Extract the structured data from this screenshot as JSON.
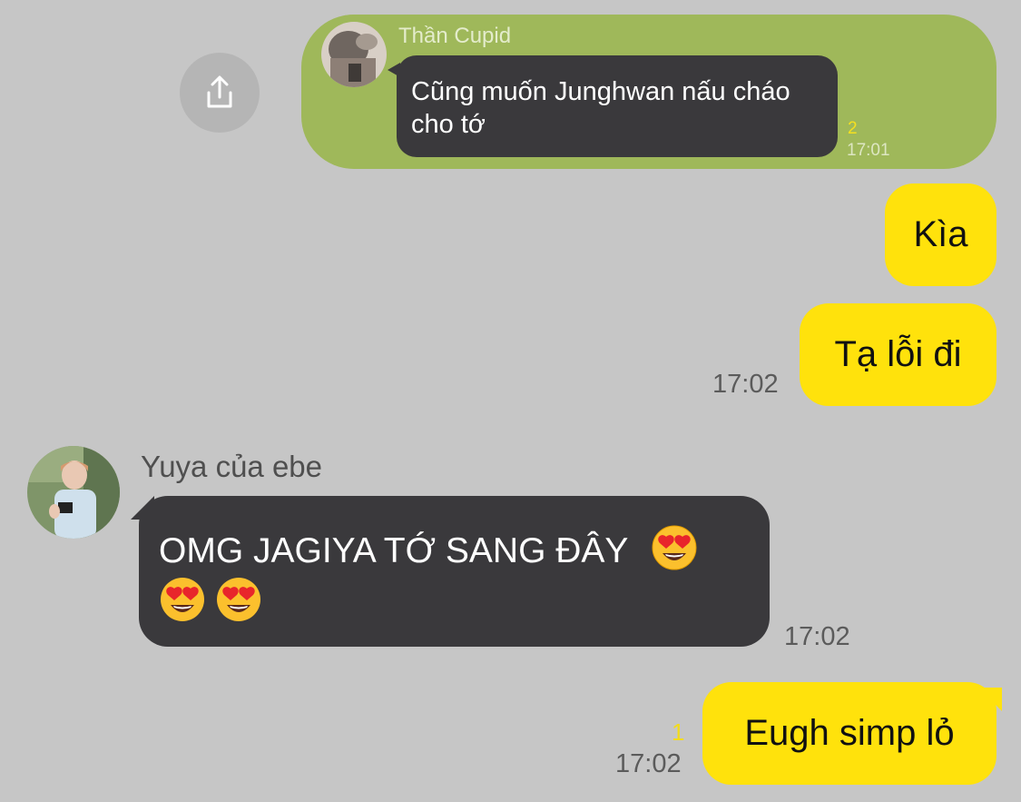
{
  "quoted": {
    "sender": "Thần Cupid",
    "text": "Cũng muốn Junghwan nấu cháo cho tớ",
    "read_count": "2",
    "time": "17:01"
  },
  "messages": [
    {
      "direction": "sent",
      "text": "Kìa"
    },
    {
      "direction": "sent",
      "text": "Tạ lỗi đi",
      "time": "17:02"
    },
    {
      "direction": "received",
      "sender": "Yuya của ebe",
      "text": "OMG JAGIYA TỚ SANG ĐÂY",
      "emoji": "heart-eyes-emoji",
      "time": "17:02"
    },
    {
      "direction": "sent",
      "text": "Eugh simp lỏ",
      "read_count": "1",
      "time": "17:02"
    }
  ],
  "icons": {
    "share": "share-icon",
    "emoji": "heart-eyes-emoji"
  },
  "colors": {
    "background": "#c6c6c6",
    "sent_bubble": "#ffe20c",
    "received_bubble": "#3a393c",
    "quote_bubble": "#9fb85a",
    "read_count": "#f3dc1a"
  }
}
